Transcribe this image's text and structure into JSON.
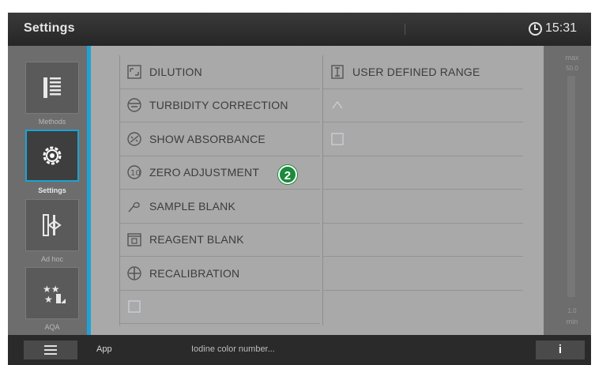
{
  "titlebar": {
    "title": "Settings",
    "time": "15:31"
  },
  "sidebar": {
    "items": [
      {
        "label": "Methods",
        "icon": "methods-icon",
        "active": false
      },
      {
        "label": "Settings",
        "icon": "gear-icon",
        "active": true
      },
      {
        "label": "Ad hoc",
        "icon": "adhoc-icon",
        "active": false
      },
      {
        "label": "AQA",
        "icon": "aqa-icon",
        "active": false
      }
    ]
  },
  "menu": {
    "left": [
      {
        "label": "DILUTION",
        "icon": "dilution-icon",
        "enabled": true
      },
      {
        "label": "TURBIDITY CORRECTION",
        "icon": "turbidity-icon",
        "enabled": true
      },
      {
        "label": "SHOW ABSORBANCE",
        "icon": "absorbance-icon",
        "enabled": true
      },
      {
        "label": "ZERO ADJUSTMENT",
        "icon": "zero-adjustment-icon",
        "enabled": true
      },
      {
        "label": "SAMPLE BLANK",
        "icon": "sample-blank-icon",
        "enabled": true
      },
      {
        "label": "REAGENT BLANK",
        "icon": "reagent-blank-icon",
        "enabled": true
      },
      {
        "label": "RECALIBRATION",
        "icon": "recalibration-icon",
        "enabled": true
      },
      {
        "label": "",
        "icon": "units-icon",
        "enabled": false
      }
    ],
    "right": [
      {
        "label": "USER DEFINED RANGE",
        "icon": "range-icon",
        "enabled": true
      },
      {
        "label": "",
        "icon": "dim-icon",
        "enabled": false
      },
      {
        "label": "",
        "icon": "dim-icon",
        "enabled": false
      }
    ]
  },
  "callout": {
    "number": "2"
  },
  "scale": {
    "max_label": "max",
    "max_value": "50.0",
    "min_value": "1.0",
    "min_label": "min"
  },
  "bottombar": {
    "app_label": "App",
    "status": "Iodine color number..."
  },
  "colors": {
    "accent": "#1ea2d6",
    "callout": "#1c8a3c"
  }
}
